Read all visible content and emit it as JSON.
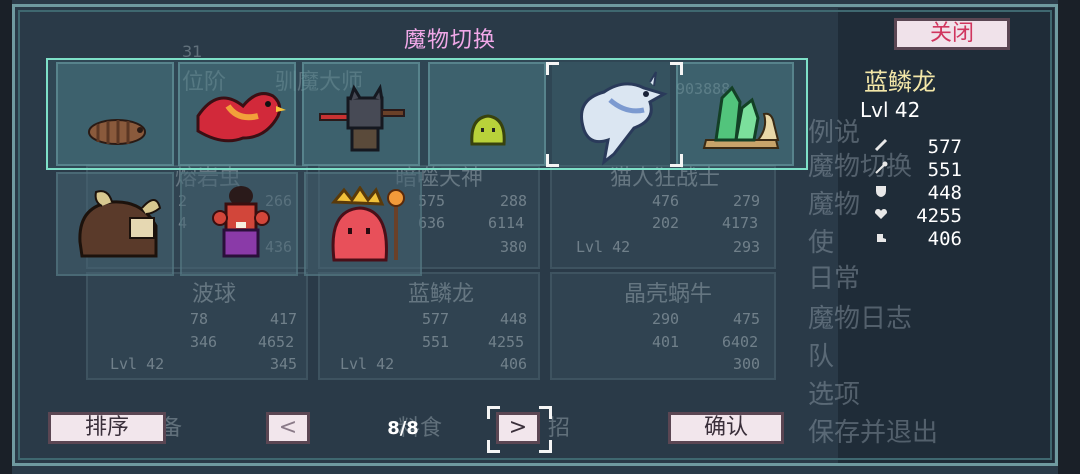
{
  "title": "魔物切换",
  "close_label": "关闭",
  "selected": {
    "name": "蓝鳞龙",
    "level": "Lvl 42",
    "stats": [
      {
        "icon": "sword-icon",
        "value": "577"
      },
      {
        "icon": "staff-icon",
        "value": "551"
      },
      {
        "icon": "shield-icon",
        "value": "448"
      },
      {
        "icon": "heart-icon",
        "value": "4255"
      },
      {
        "icon": "boot-icon",
        "value": "406"
      }
    ]
  },
  "row1": [
    "grub",
    "phoenix",
    "cat-warrior",
    "slime",
    "ice-dragon",
    "crystal-snail"
  ],
  "row2": [
    "buffalo",
    "fire-imp",
    "slime-king"
  ],
  "sort_label": "排序",
  "prev_label": "<",
  "page_label": "8/8",
  "next_label": ">",
  "confirm_label": "确认",
  "background": {
    "count": "31",
    "rank_label": "位阶",
    "tamer_label": "驯魔大师",
    "id_number": "903888",
    "cards": [
      {
        "name": "熔岩虫",
        "s1": "2",
        "s1b": "266",
        "s2": "4",
        "s2b": "436"
      },
      {
        "name": "暗噬天神",
        "s1": "575",
        "s1b": "288",
        "s2": "636",
        "s2b": "6114",
        "s3": "380"
      },
      {
        "name": "猫人狂战士",
        "s1": "476",
        "s1b": "279",
        "s2": "202",
        "s2b": "4173",
        "s3": "293",
        "lvl": "Lvl 42"
      },
      {
        "name": "波球",
        "s1": "78",
        "s1b": "417",
        "s2": "346",
        "s2b": "4652",
        "s3": "345",
        "lvl": "Lvl 42"
      },
      {
        "name": "蓝鳞龙",
        "s1": "577",
        "s1b": "448",
        "s2": "551",
        "s2b": "4255",
        "s3": "406",
        "lvl": "Lvl 42"
      },
      {
        "name": "晶壳蜗牛",
        "s1": "290",
        "s1b": "475",
        "s2": "401",
        "s2b": "6402",
        "s3": "300"
      }
    ],
    "menu": [
      "例说",
      "魔物切换",
      "魔物",
      "使",
      "日常",
      "魔物日志",
      "队",
      "选项",
      "保存并退出"
    ],
    "bottom_labels": [
      "备",
      "料食",
      "招"
    ]
  }
}
